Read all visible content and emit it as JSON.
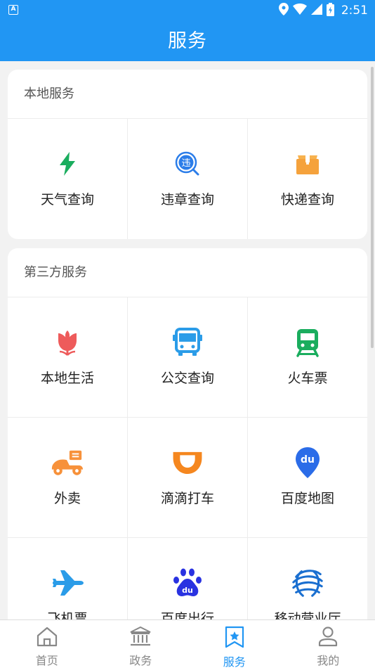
{
  "status_bar": {
    "badge": "A",
    "time": "2:51"
  },
  "header": {
    "title": "服务"
  },
  "local_services": {
    "heading": "本地服务",
    "items": [
      {
        "label": "天气查询",
        "icon": "lightning-icon"
      },
      {
        "label": "违章查询",
        "icon": "violation-search-icon"
      },
      {
        "label": "快递查询",
        "icon": "package-icon"
      }
    ]
  },
  "third_party": {
    "heading": "第三方服务",
    "items": [
      {
        "label": "本地生活",
        "icon": "tulip-icon"
      },
      {
        "label": "公交查询",
        "icon": "bus-icon"
      },
      {
        "label": "火车票",
        "icon": "train-icon"
      },
      {
        "label": "外卖",
        "icon": "delivery-scooter-icon"
      },
      {
        "label": "滴滴打车",
        "icon": "didi-icon"
      },
      {
        "label": "百度地图",
        "icon": "map-pin-icon"
      },
      {
        "label": "飞机票",
        "icon": "airplane-icon"
      },
      {
        "label": "百度出行",
        "icon": "baidu-paw-icon"
      },
      {
        "label": "移动营业厅",
        "icon": "china-mobile-icon"
      }
    ]
  },
  "tabs": [
    {
      "label": "首页",
      "icon": "home-icon",
      "active": false
    },
    {
      "label": "政务",
      "icon": "government-icon",
      "active": false
    },
    {
      "label": "服务",
      "icon": "star-bookmark-icon",
      "active": true
    },
    {
      "label": "我的",
      "icon": "user-icon",
      "active": false
    }
  ],
  "colors": {
    "primary": "#2196f3",
    "weather": "#1aad5e",
    "violation": "#2b7de9",
    "express": "#f5a23c",
    "local_life": "#ee5b5b",
    "bus": "#2b9ce8",
    "train": "#1aad5e",
    "takeaway": "#f7913a",
    "didi": "#f5871f",
    "baidu": "#2932e1",
    "flight": "#2b9ce8",
    "mobile": "#1a6fd0"
  }
}
